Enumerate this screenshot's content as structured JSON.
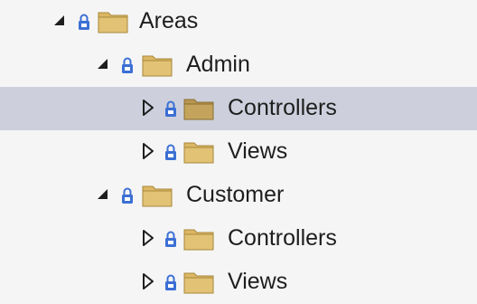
{
  "tree": {
    "nodes": [
      {
        "label": "Areas",
        "expanded": true,
        "selected": false
      },
      {
        "label": "Admin",
        "expanded": true,
        "selected": false
      },
      {
        "label": "Controllers",
        "expanded": false,
        "selected": true
      },
      {
        "label": "Views",
        "expanded": false,
        "selected": false
      },
      {
        "label": "Customer",
        "expanded": true,
        "selected": false
      },
      {
        "label": "Controllers",
        "expanded": false,
        "selected": false
      },
      {
        "label": "Views",
        "expanded": false,
        "selected": false
      }
    ]
  },
  "colors": {
    "selected_row": "#cdd0dc",
    "lock": "#3b6fd4",
    "folder": "#dcb764",
    "arrow": "#1e1e1e"
  },
  "icons": {
    "expanded": "expanded-triangle-icon",
    "collapsed": "collapsed-triangle-icon",
    "lock": "lock-icon",
    "folder": "folder-icon"
  }
}
